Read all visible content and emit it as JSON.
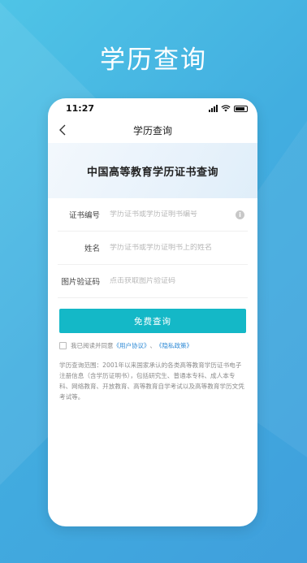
{
  "hero": {
    "title": "学历查询"
  },
  "status_bar": {
    "time": "11:27"
  },
  "nav": {
    "title": "学历查询"
  },
  "banner": {
    "title": "中国高等教育学历证书查询"
  },
  "form": {
    "cert_number": {
      "label": "证书编号",
      "placeholder": "学历证书或学历证明书编号"
    },
    "name": {
      "label": "姓名",
      "placeholder": "学历证书或学历证明书上的姓名"
    },
    "captcha": {
      "label": "图片验证码",
      "placeholder": "点击获取图片验证码"
    }
  },
  "submit_label": "免费查询",
  "agreement": {
    "prefix": "我已阅读并同意",
    "user_agreement": "《用户协议》",
    "separator": "、",
    "privacy_policy": "《隐私政策》"
  },
  "description": "学历查询范围：2001年以来国家承认的各类高等教育学历证书电子注册信息（含学历证明书），包括研究生、普通本专科、成人本专科、网络教育、开放教育、高等教育自学考试以及高等教育学历文凭考试等。",
  "colors": {
    "accent": "#14b8c7",
    "link": "#2d8ad6",
    "background": "#42aee0"
  },
  "icons": [
    "back-icon",
    "signal-icon",
    "wifi-icon",
    "battery-icon",
    "info-icon",
    "checkbox-icon"
  ]
}
